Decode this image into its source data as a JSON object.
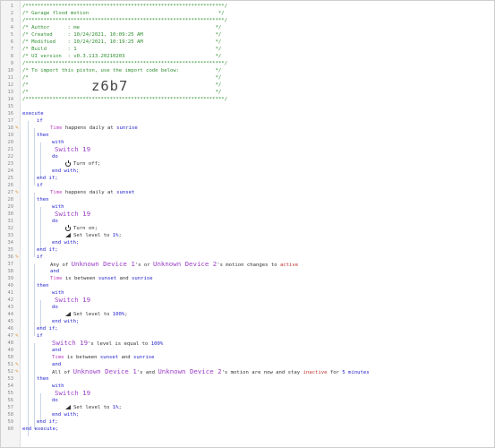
{
  "header": {
    "rule_top": "/******************************************************************/",
    "title": "/* Garage flood motion                                           */",
    "rule_mid": "/******************************************************************/",
    "author": "/* Author      : me                                             */",
    "created": "/* Created     : 10/24/2021, 10:09:25 AM                        */",
    "modified": "/* Modified    : 10/24/2021, 10:19:25 AM                        */",
    "build": "/* Build       : 1                                              */",
    "ui_version": "/* UI version  : v0.3.113.20210203                              */",
    "rule_mid2": "/******************************************************************/",
    "import": "/* To import this piston, use the import code below:            */",
    "blank1": "/*                                                              */",
    "code_line": "/*                                                              */",
    "blank2": "/*                                                              */",
    "rule_bottom": "/******************************************************************/",
    "import_code": "z6b7"
  },
  "line_numbers": [
    "1",
    "2",
    "3",
    "4",
    "5",
    "6",
    "7",
    "8",
    "9",
    "10",
    "11",
    "12",
    "13",
    "14",
    "15",
    "16",
    "17",
    "18",
    "19",
    "20",
    "21",
    "22",
    "23",
    "24",
    "25",
    "26",
    "27",
    "28",
    "29",
    "30",
    "31",
    "32",
    "33",
    "34",
    "35",
    "36",
    "37",
    "38",
    "39",
    "40",
    "41",
    "42",
    "43",
    "44",
    "45",
    "46",
    "47",
    "48",
    "49",
    "50",
    "51",
    "52",
    "53",
    "54",
    "55",
    "56",
    "57",
    "58",
    "59",
    "60"
  ],
  "kw": {
    "execute": "execute",
    "if": "if",
    "then": "then",
    "with": "with",
    "do": "do",
    "end_with": "end with;",
    "end_if": "end if;",
    "and": "and",
    "end_execute": "end execute;"
  },
  "block1": {
    "time": "Time",
    "happens": " happens daily at ",
    "moment": "sunrise",
    "device": "Switch 19",
    "action": "Turn off;"
  },
  "block2": {
    "time": "Time",
    "happens": " happens daily at ",
    "moment": "sunset",
    "device": "Switch 19",
    "action_on": "Turn on;",
    "action_level": "Set level to ",
    "level": "1%",
    "semi": ";"
  },
  "block3": {
    "any_of": "Any of ",
    "dev1": "Unknown Device 1",
    "mid1": "'s or ",
    "dev2": "Unknown Device 2",
    "mid2": "'s motion changes to ",
    "state": "active",
    "time": "Time",
    "between": " is between ",
    "from": "sunset",
    "and_word": " and ",
    "to": "sunrise",
    "device": "Switch 19",
    "action_level": "Set level to ",
    "level": "100%",
    "semi": ";"
  },
  "block4": {
    "device_cond": "Switch 19",
    "level_eq": "'s level is equal to ",
    "level_val": "100%",
    "time": "Time",
    "between": " is between ",
    "from": "sunset",
    "and_word": " and ",
    "to": "sunrise",
    "all_of": "All of ",
    "dev1": "Unknown Device 1",
    "mid1": "'s and ",
    "dev2": "Unknown Device 2",
    "mid2": "'s motion are now and stay ",
    "state": "inactive",
    "for": " for ",
    "duration": "5 minutes",
    "device": "Switch 19",
    "action_level": "Set level to ",
    "level": "1%",
    "semi": ";"
  }
}
